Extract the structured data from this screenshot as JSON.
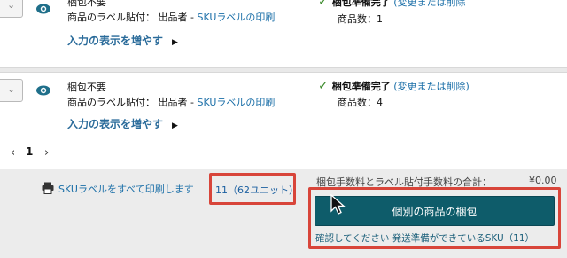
{
  "items": [
    {
      "title": "梱包不要",
      "label_prefix": "商品のラベル貼付：",
      "label_who": "出品者 - ",
      "label_link": "SKUラベルの印刷",
      "more_label": "入力の表示を増やす",
      "status": "梱包準備完了",
      "edit_link": "(変更または削除",
      "quantity": "商品数：1"
    },
    {
      "title": "梱包不要",
      "label_prefix": "商品のラベル貼付：",
      "label_who": "出品者 - ",
      "label_link": "SKUラベルの印刷",
      "more_label": "入力の表示を増やす",
      "status": "梱包準備完了",
      "edit_link": "(変更または削除)",
      "quantity": "商品数：4"
    }
  ],
  "pagination": {
    "prev": "‹",
    "current": "1",
    "next": "›"
  },
  "footer": {
    "print_all_label": "SKUラベルをすべて印刷します",
    "unit_count": "11（62ユニット）",
    "fees_label": "梱包手数料とラベル貼付手数料の合計：",
    "fees_amount": "¥0.00",
    "pack_button_label": "個別の商品の梱包",
    "confirm_text": "確認してください 発送準備ができているSKU（11）"
  },
  "colors": {
    "accent_teal": "#0e5c6a",
    "link_blue": "#1b6fa8",
    "highlight_red": "#d8453a",
    "check_green": "#3a8a2a"
  }
}
